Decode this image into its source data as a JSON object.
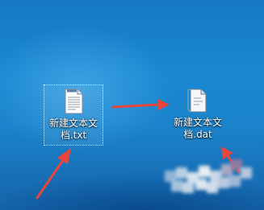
{
  "desktop": {
    "background_color": "#1a86d0",
    "icons": [
      {
        "label": "新建文本文档.txt",
        "icon": "text-document-icon",
        "selected": true
      },
      {
        "label": "新建文本文档.dat",
        "icon": "generic-file-icon",
        "selected": false
      }
    ]
  },
  "annotations": {
    "arrow_color": "#e8453c"
  }
}
